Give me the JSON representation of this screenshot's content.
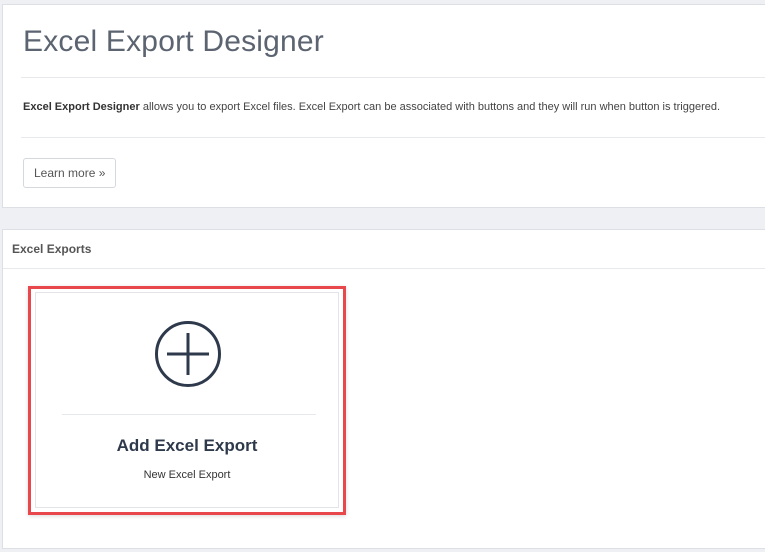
{
  "header": {
    "title": "Excel Export Designer",
    "description_bold": "Excel Export Designer",
    "description_rest": " allows you to export Excel files. Excel Export can be associated with buttons and they will run when button is triggered.",
    "learn_more_label": "Learn more »"
  },
  "exports": {
    "section_title": "Excel Exports",
    "add_card": {
      "icon": "plus-circle-icon",
      "title": "Add Excel Export",
      "subtitle": "New Excel Export"
    }
  },
  "colors": {
    "highlight": "#e8474c",
    "icon": "#2e3a4b",
    "background": "#eff0f3"
  }
}
